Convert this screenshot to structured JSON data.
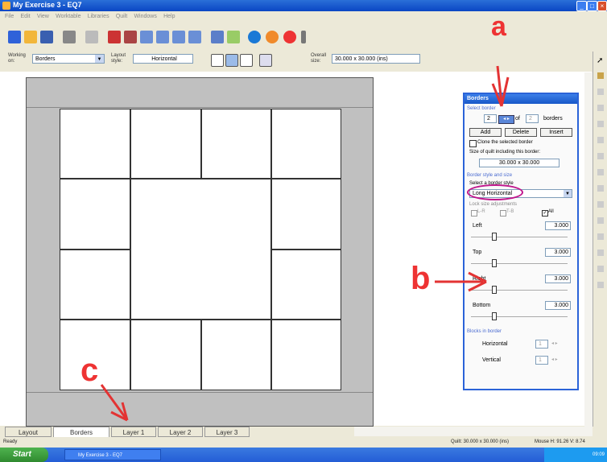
{
  "window": {
    "title": "My Exercise 3 - EQ7"
  },
  "menu": {
    "items": [
      "File",
      "Edit",
      "View",
      "Worktable",
      "Libraries",
      "Quilt",
      "Windows",
      "Help"
    ]
  },
  "options_bar": {
    "working_on_label": "Working on:",
    "working_on_value": "Borders",
    "layout_style_label": "Layout style:",
    "layout_style_value": "Horizontal",
    "overall_size_label": "Overall size:",
    "overall_size_value": "30.000 x 30.000 (ins)"
  },
  "borders_panel": {
    "title": "Borders",
    "select_border_label": "Select border",
    "border_index": "2",
    "of_label": "of",
    "border_total": "2",
    "borders_label": "borders",
    "add_label": "Add",
    "delete_label": "Delete",
    "insert_label": "Insert",
    "clone_label": "Clone the selected border",
    "size_including_label": "Size of quilt including this border:",
    "size_including_value": "30.000 x 30.000",
    "style_section_label": "Border style and size",
    "select_style_label": "Select a border style",
    "style_value": "Long Horizontal",
    "lock_label": "Lock size adjustments",
    "lock_lr_label": "L-R",
    "lock_tb_label": "T-B",
    "lock_all_label": "All",
    "left_label": "Left",
    "left_value": "3.000",
    "top_label": "Top",
    "top_value": "3.000",
    "right_label": "Right",
    "right_value": "3.000",
    "bottom_label": "Bottom",
    "bottom_value": "3.000",
    "blocks_section_label": "Blocks in border",
    "horizontal_label": "Horizontal",
    "horizontal_value": "1",
    "vertical_label": "Vertical",
    "vertical_value": "1"
  },
  "tabs": [
    "Layout",
    "Borders",
    "Layer 1",
    "Layer 2",
    "Layer 3"
  ],
  "status": {
    "left": "Ready",
    "quilt": "Quilt: 30.000 x 30.000 (ins)",
    "mouse": "Mouse H: 91.26 V: 8.74"
  },
  "taskbar": {
    "start_label": "Start",
    "task_label": "My Exercise 3 - EQ7",
    "tray_time": "09:09"
  },
  "annotations": {
    "a": "a",
    "b": "b",
    "c": "c"
  },
  "colors": {
    "annotation": "#e33333",
    "panel_border": "#2b63d8",
    "quilt_border": "#c0c0c0",
    "highlight_ellipse": "#c0168c"
  }
}
